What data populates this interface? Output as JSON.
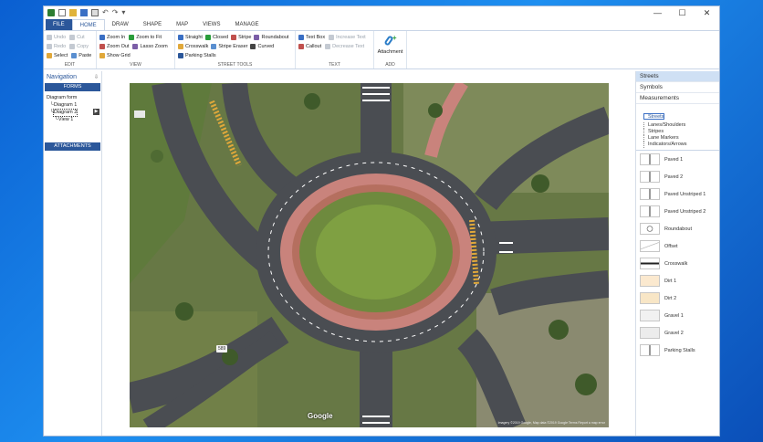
{
  "titlebar": {
    "window_controls": {
      "minimize": "—",
      "maximize": "☐",
      "close": "✕"
    }
  },
  "tabs": [
    {
      "label": "FILE",
      "kind": "file"
    },
    {
      "label": "HOME",
      "kind": "active"
    },
    {
      "label": "DRAW",
      "kind": "normal"
    },
    {
      "label": "SHAPE",
      "kind": "normal"
    },
    {
      "label": "MAP",
      "kind": "normal"
    },
    {
      "label": "VIEWS",
      "kind": "normal"
    },
    {
      "label": "MANAGE",
      "kind": "normal"
    }
  ],
  "ribbon": {
    "edit": {
      "label": "EDIT",
      "items": [
        {
          "label": "Undo",
          "disabled": true,
          "icon": "undo-icon"
        },
        {
          "label": "Cut",
          "disabled": true,
          "icon": "cut-icon"
        },
        {
          "label": "Redo",
          "disabled": true,
          "icon": "redo-icon"
        },
        {
          "label": "Copy",
          "disabled": true,
          "icon": "copy-icon"
        },
        {
          "label": "Select",
          "disabled": false,
          "icon": "select-icon"
        },
        {
          "label": "Paste",
          "disabled": false,
          "icon": "paste-icon"
        }
      ]
    },
    "view": {
      "label": "VIEW",
      "items": [
        {
          "label": "Zoom In",
          "icon": "zoom-in-icon"
        },
        {
          "label": "Zoom to Fit",
          "icon": "zoom-fit-icon"
        },
        {
          "label": "Zoom Out",
          "icon": "zoom-out-icon"
        },
        {
          "label": "Lasso Zoom",
          "icon": "lasso-zoom-icon"
        },
        {
          "label": "Show Grid",
          "icon": "grid-icon"
        }
      ]
    },
    "street_tools": {
      "label": "STREET TOOLS",
      "items": [
        {
          "label": "Straight",
          "icon": "straight-icon"
        },
        {
          "label": "Closed",
          "icon": "closed-icon"
        },
        {
          "label": "Stripe",
          "icon": "stripe-icon"
        },
        {
          "label": "Roundabout",
          "icon": "roundabout-icon"
        },
        {
          "label": "Crosswalk",
          "icon": "crosswalk-icon"
        },
        {
          "label": "Stripe Eraser",
          "icon": "stripe-eraser-icon"
        },
        {
          "label": "Curved",
          "icon": "curved-icon"
        },
        {
          "label": "Parking Stalls",
          "icon": "parking-stalls-icon"
        }
      ]
    },
    "text": {
      "label": "TEXT",
      "items": [
        {
          "label": "Text Box",
          "disabled": false,
          "icon": "text-box-icon"
        },
        {
          "label": "Increase Text",
          "disabled": true,
          "icon": "increase-text-icon"
        },
        {
          "label": "Callout",
          "disabled": false,
          "icon": "callout-icon"
        },
        {
          "label": "Decrease Text",
          "disabled": true,
          "icon": "decrease-text-icon"
        }
      ]
    },
    "add": {
      "label": "ADD",
      "attachment": "Attachment"
    }
  },
  "navigation": {
    "title": "Navigation",
    "pin": "⇩",
    "forms_header": "FORMS",
    "tree": {
      "root": "Diagram form",
      "d1": "Diagram 1",
      "d2": "Diagram 2",
      "v1": "View 1"
    },
    "attachments_header": "ATTACHMENTS"
  },
  "map": {
    "google": "Google",
    "credit": "Imagery ©2019 Google, Map data ©2019 Google   Terms   Report a map error",
    "shield": "589"
  },
  "symbols_panel": {
    "headers": [
      "Streets",
      "Symbols",
      "Measurements"
    ],
    "subitems": [
      "Streets",
      "Lanes/Shoulders",
      "Stripes",
      "Lane Markers",
      "Indicators/Arrows"
    ],
    "items": [
      {
        "label": "Paved 1",
        "icon": "paved-1-icon",
        "fill": "#ffffff"
      },
      {
        "label": "Paved 2",
        "icon": "paved-2-icon",
        "fill": "#ffffff"
      },
      {
        "label": "Paved Unstriped 1",
        "icon": "paved-unstriped-1-icon",
        "fill": "#ffffff"
      },
      {
        "label": "Paved Unstriped 2",
        "icon": "paved-unstriped-2-icon",
        "fill": "#ffffff"
      },
      {
        "label": "Roundabout",
        "icon": "roundabout-symbol-icon",
        "fill": "#ffffff"
      },
      {
        "label": "Offset",
        "icon": "offset-icon",
        "fill": "#ffffff"
      },
      {
        "label": "Crosswalk",
        "icon": "crosswalk-symbol-icon",
        "fill": "#ffffff"
      },
      {
        "label": "Dirt 1",
        "icon": "dirt-1-icon",
        "fill": "#fbe9cf"
      },
      {
        "label": "Dirt 2",
        "icon": "dirt-2-icon",
        "fill": "#f8e6c6"
      },
      {
        "label": "Gravel 1",
        "icon": "gravel-1-icon",
        "fill": "#f1f1f1"
      },
      {
        "label": "Gravel 2",
        "icon": "gravel-2-icon",
        "fill": "#ececec"
      },
      {
        "label": "Parking Stalls",
        "icon": "parking-stalls-symbol-icon",
        "fill": "#ffffff"
      }
    ]
  },
  "colors": {
    "accent": "#2b579a",
    "grass": "#5f7a3c",
    "asphalt": "#4a4d52",
    "brick": "#c9837c"
  }
}
